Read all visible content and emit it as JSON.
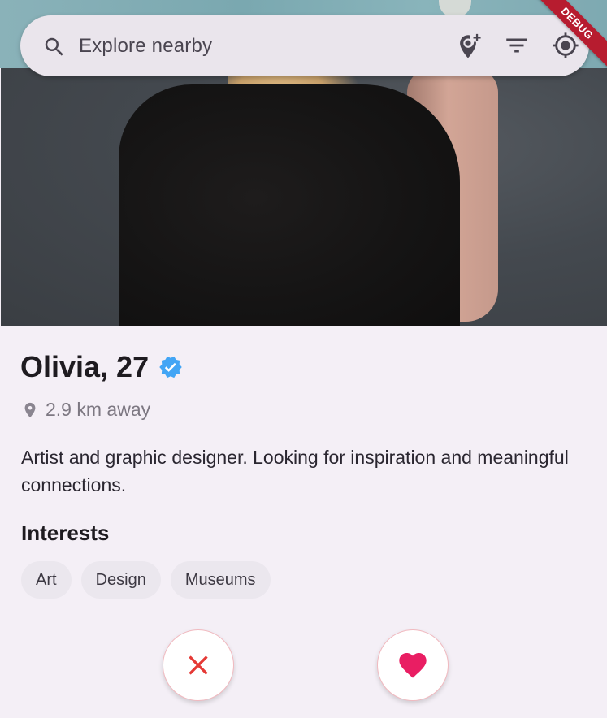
{
  "search": {
    "placeholder": "Explore nearby",
    "icons": [
      "search-icon",
      "add-location-icon",
      "filter-icon",
      "my-location-icon"
    ]
  },
  "debug_banner": "DEBUG",
  "profile": {
    "name_age": "Olivia, 27",
    "verified": true,
    "distance": "2.9 km away",
    "bio": "Artist and graphic designer. Looking for inspiration and meaningful connections.",
    "interests_title": "Interests",
    "interests": [
      "Art",
      "Design",
      "Museums"
    ]
  },
  "actions": {
    "dislike_icon": "close-icon",
    "like_icon": "heart-icon"
  },
  "colors": {
    "accent_pink": "#e91e63",
    "dislike_red": "#e53935",
    "verified_blue": "#42a5f5"
  }
}
